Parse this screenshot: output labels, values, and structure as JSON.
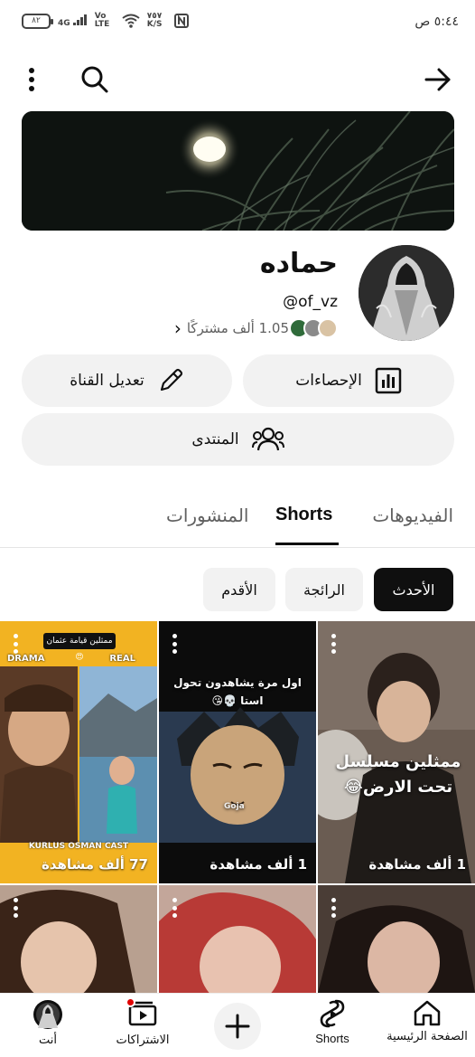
{
  "status_bar": {
    "battery": "٨٢",
    "network": "4G",
    "volte": "Vo LTE",
    "speed": "٧٥٧ K/S",
    "time": "٥:٤٤ ص"
  },
  "channel": {
    "name": "حماده",
    "handle": "@of_vz",
    "subscribers": "1.05 ألف مشتركًا",
    "subscribers_chevron": "›"
  },
  "actions": {
    "stats_label": "الإحصاءات",
    "edit_label": "تعديل القناة",
    "community_label": "المنتدى"
  },
  "tabs": [
    {
      "label": "الفيديوهات"
    },
    {
      "label": "Shorts"
    },
    {
      "label": "المنشورات"
    }
  ],
  "chips": [
    {
      "label": "الأحدث"
    },
    {
      "label": "الرائجة"
    },
    {
      "label": "الأقدم"
    }
  ],
  "shorts": [
    {
      "caption": "ممثلين مسلسل تحت الارض😂",
      "views": "1 ألف مشاهدة"
    },
    {
      "caption": "اول مرة يشاهدون تحول استا 💀😘",
      "views": "1 ألف مشاهدة",
      "tag": "Goja"
    },
    {
      "caption": "ممثلين قيامة عثمان 😍",
      "views": "77 ألف مشاهدة",
      "label_left": "DRAMA",
      "label_right": "REAL",
      "footer": "KURLUS OSMAN CAST"
    }
  ],
  "bottom_nav": {
    "home": "الصفحة الرئيسية",
    "shorts": "Shorts",
    "subscriptions": "الاشتراكات",
    "you": "أنت"
  },
  "colors": {
    "accent": "#0f0f0f",
    "chip_bg": "#f2f2f2",
    "yellow_card": "#f2b322",
    "notification_dot": "#e00000"
  }
}
